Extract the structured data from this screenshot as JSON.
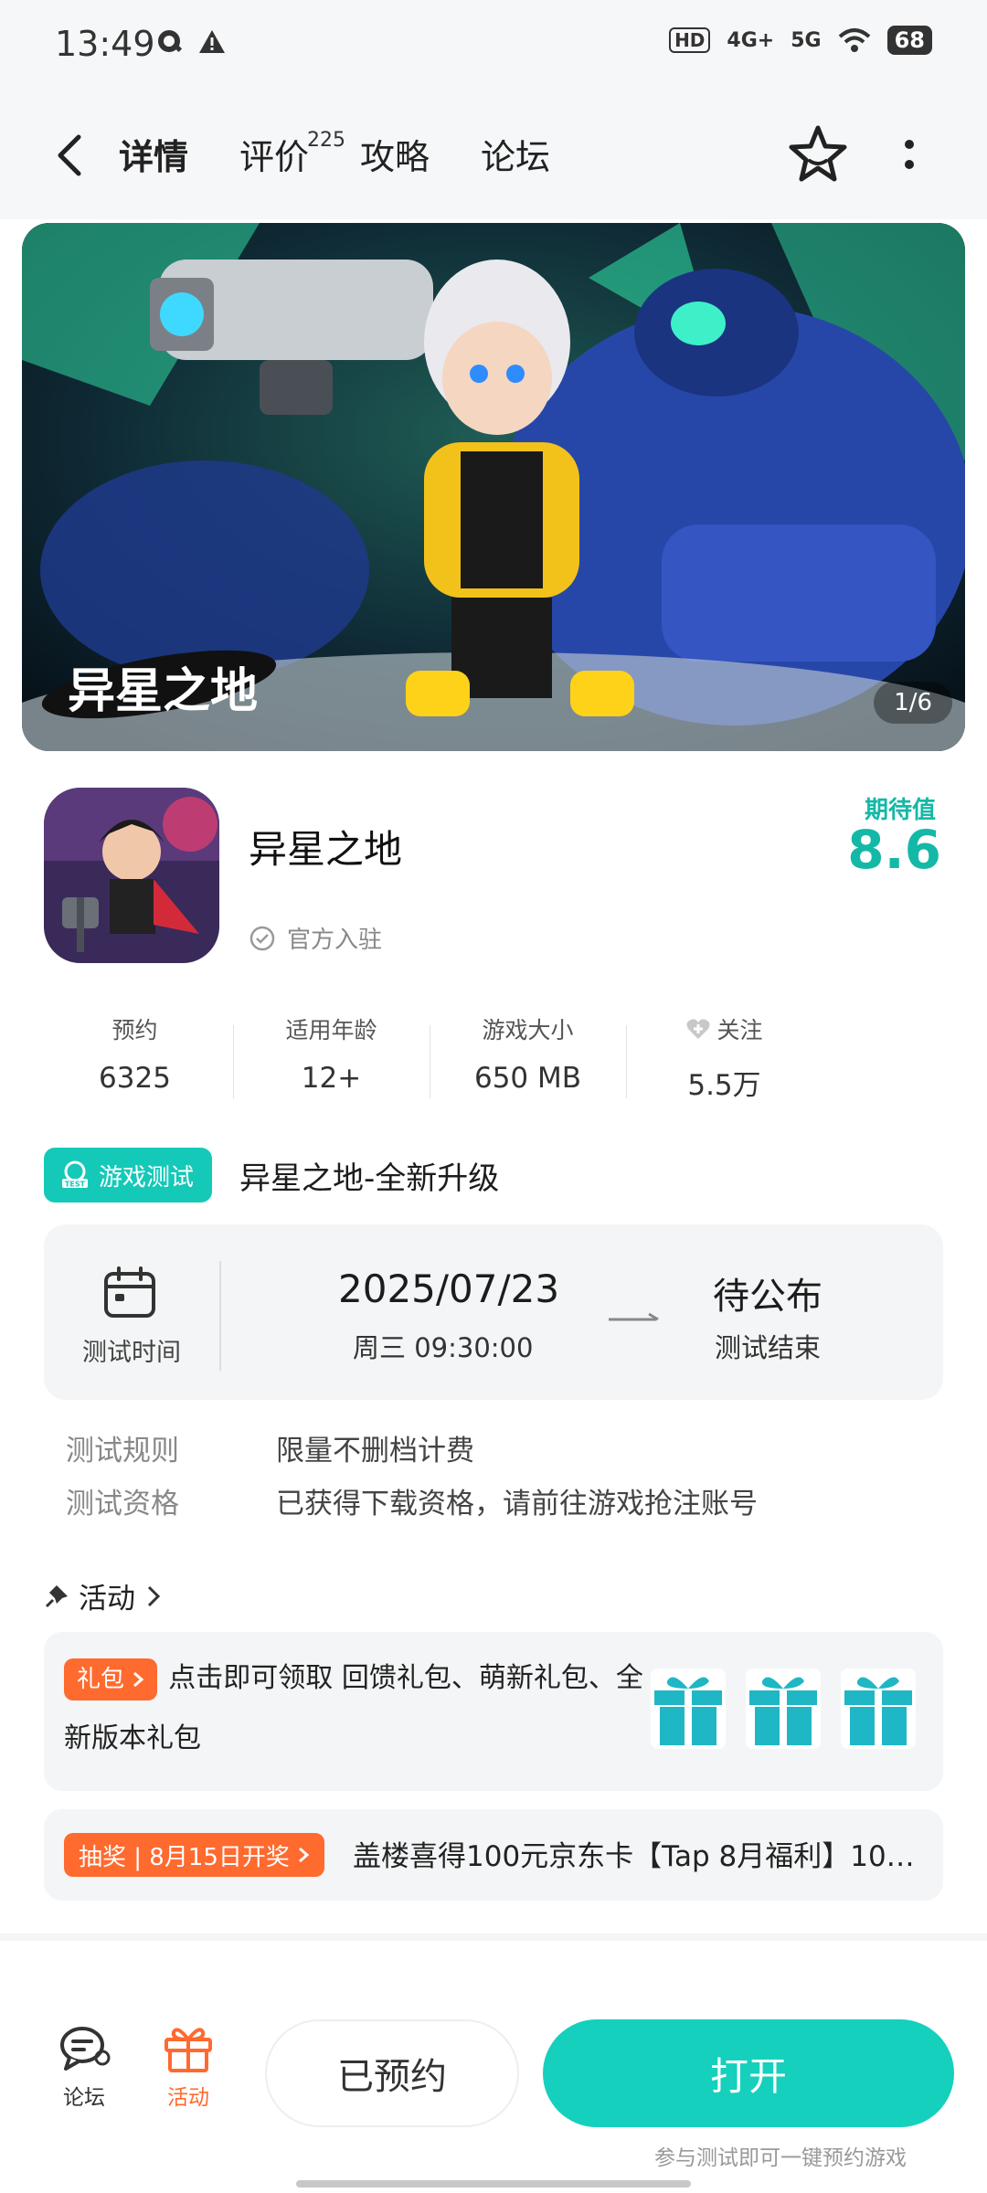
{
  "status_bar": {
    "time": "13:49",
    "network_1": "4G+",
    "network_2": "5G",
    "battery": "68",
    "hd_label": "HD"
  },
  "nav": {
    "tabs": [
      {
        "label": "详情",
        "active": true
      },
      {
        "label": "评价",
        "badge": "225"
      },
      {
        "label": "攻略"
      },
      {
        "label": "论坛"
      }
    ]
  },
  "banner": {
    "counter": "1/6",
    "logo_text": "异星之地"
  },
  "app": {
    "name": "异星之地",
    "official_label": "官方入驻",
    "expect_label": "期待值",
    "expect_value": "8.6"
  },
  "stats": [
    {
      "label": "预约",
      "value": "6325"
    },
    {
      "label": "适用年龄",
      "value": "12+"
    },
    {
      "label": "游戏大小",
      "value": "650 MB"
    },
    {
      "label": "关注",
      "value": "5.5万",
      "icon": "heart-icon"
    }
  ],
  "test": {
    "tag_label": "游戏测试",
    "tag_small": "TEST",
    "title": "异星之地-全新升级",
    "time_label": "测试时间",
    "start_date": "2025/07/23",
    "start_time": "周三  09:30:00",
    "end_date": "待公布",
    "end_label": "测试结束",
    "rules": [
      {
        "label": "测试规则",
        "value": "限量不删档计费"
      },
      {
        "label": "测试资格",
        "value": "已获得下载资格，请前往游戏抢注账号"
      }
    ]
  },
  "activity": {
    "header": "活动",
    "gift_tag": "礼包",
    "gift_text": "点击即可领取 回馈礼包、萌新礼包、全新版本礼包",
    "lottery_tag": "抽奖 | 8月15日开奖",
    "lottery_text": "盖楼喜得100元京东卡【Tap 8月福利】10…"
  },
  "bottom_bar": {
    "forum_label": "论坛",
    "activity_label": "活动",
    "reserved_label": "已预约",
    "open_label": "打开",
    "hint": "参与测试即可一键预约游戏"
  },
  "colors": {
    "accent": "#14c9b8",
    "orange": "#ff6a2f",
    "card_bg": "#f4f5f6"
  }
}
